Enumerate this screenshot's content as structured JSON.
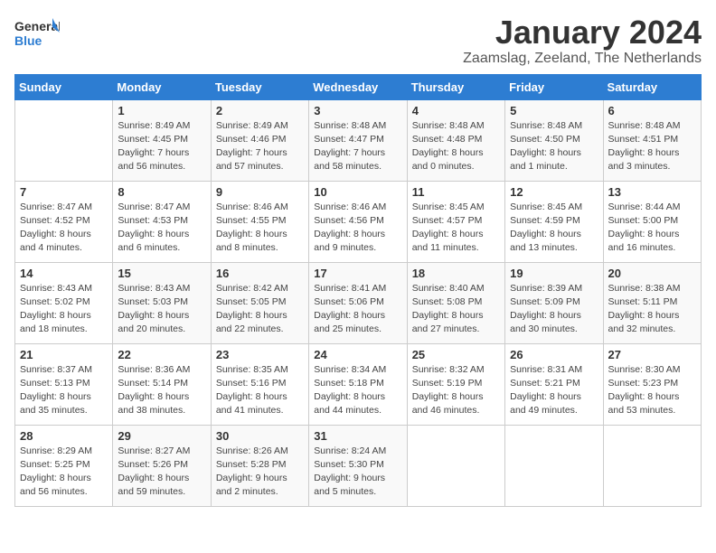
{
  "header": {
    "logo_general": "General",
    "logo_blue": "Blue",
    "title": "January 2024",
    "subtitle": "Zaamslag, Zeeland, The Netherlands"
  },
  "days_of_week": [
    "Sunday",
    "Monday",
    "Tuesday",
    "Wednesday",
    "Thursday",
    "Friday",
    "Saturday"
  ],
  "weeks": [
    [
      {
        "day": "",
        "info": ""
      },
      {
        "day": "1",
        "info": "Sunrise: 8:49 AM\nSunset: 4:45 PM\nDaylight: 7 hours\nand 56 minutes."
      },
      {
        "day": "2",
        "info": "Sunrise: 8:49 AM\nSunset: 4:46 PM\nDaylight: 7 hours\nand 57 minutes."
      },
      {
        "day": "3",
        "info": "Sunrise: 8:48 AM\nSunset: 4:47 PM\nDaylight: 7 hours\nand 58 minutes."
      },
      {
        "day": "4",
        "info": "Sunrise: 8:48 AM\nSunset: 4:48 PM\nDaylight: 8 hours\nand 0 minutes."
      },
      {
        "day": "5",
        "info": "Sunrise: 8:48 AM\nSunset: 4:50 PM\nDaylight: 8 hours\nand 1 minute."
      },
      {
        "day": "6",
        "info": "Sunrise: 8:48 AM\nSunset: 4:51 PM\nDaylight: 8 hours\nand 3 minutes."
      }
    ],
    [
      {
        "day": "7",
        "info": "Sunrise: 8:47 AM\nSunset: 4:52 PM\nDaylight: 8 hours\nand 4 minutes."
      },
      {
        "day": "8",
        "info": "Sunrise: 8:47 AM\nSunset: 4:53 PM\nDaylight: 8 hours\nand 6 minutes."
      },
      {
        "day": "9",
        "info": "Sunrise: 8:46 AM\nSunset: 4:55 PM\nDaylight: 8 hours\nand 8 minutes."
      },
      {
        "day": "10",
        "info": "Sunrise: 8:46 AM\nSunset: 4:56 PM\nDaylight: 8 hours\nand 9 minutes."
      },
      {
        "day": "11",
        "info": "Sunrise: 8:45 AM\nSunset: 4:57 PM\nDaylight: 8 hours\nand 11 minutes."
      },
      {
        "day": "12",
        "info": "Sunrise: 8:45 AM\nSunset: 4:59 PM\nDaylight: 8 hours\nand 13 minutes."
      },
      {
        "day": "13",
        "info": "Sunrise: 8:44 AM\nSunset: 5:00 PM\nDaylight: 8 hours\nand 16 minutes."
      }
    ],
    [
      {
        "day": "14",
        "info": "Sunrise: 8:43 AM\nSunset: 5:02 PM\nDaylight: 8 hours\nand 18 minutes."
      },
      {
        "day": "15",
        "info": "Sunrise: 8:43 AM\nSunset: 5:03 PM\nDaylight: 8 hours\nand 20 minutes."
      },
      {
        "day": "16",
        "info": "Sunrise: 8:42 AM\nSunset: 5:05 PM\nDaylight: 8 hours\nand 22 minutes."
      },
      {
        "day": "17",
        "info": "Sunrise: 8:41 AM\nSunset: 5:06 PM\nDaylight: 8 hours\nand 25 minutes."
      },
      {
        "day": "18",
        "info": "Sunrise: 8:40 AM\nSunset: 5:08 PM\nDaylight: 8 hours\nand 27 minutes."
      },
      {
        "day": "19",
        "info": "Sunrise: 8:39 AM\nSunset: 5:09 PM\nDaylight: 8 hours\nand 30 minutes."
      },
      {
        "day": "20",
        "info": "Sunrise: 8:38 AM\nSunset: 5:11 PM\nDaylight: 8 hours\nand 32 minutes."
      }
    ],
    [
      {
        "day": "21",
        "info": "Sunrise: 8:37 AM\nSunset: 5:13 PM\nDaylight: 8 hours\nand 35 minutes."
      },
      {
        "day": "22",
        "info": "Sunrise: 8:36 AM\nSunset: 5:14 PM\nDaylight: 8 hours\nand 38 minutes."
      },
      {
        "day": "23",
        "info": "Sunrise: 8:35 AM\nSunset: 5:16 PM\nDaylight: 8 hours\nand 41 minutes."
      },
      {
        "day": "24",
        "info": "Sunrise: 8:34 AM\nSunset: 5:18 PM\nDaylight: 8 hours\nand 44 minutes."
      },
      {
        "day": "25",
        "info": "Sunrise: 8:32 AM\nSunset: 5:19 PM\nDaylight: 8 hours\nand 46 minutes."
      },
      {
        "day": "26",
        "info": "Sunrise: 8:31 AM\nSunset: 5:21 PM\nDaylight: 8 hours\nand 49 minutes."
      },
      {
        "day": "27",
        "info": "Sunrise: 8:30 AM\nSunset: 5:23 PM\nDaylight: 8 hours\nand 53 minutes."
      }
    ],
    [
      {
        "day": "28",
        "info": "Sunrise: 8:29 AM\nSunset: 5:25 PM\nDaylight: 8 hours\nand 56 minutes."
      },
      {
        "day": "29",
        "info": "Sunrise: 8:27 AM\nSunset: 5:26 PM\nDaylight: 8 hours\nand 59 minutes."
      },
      {
        "day": "30",
        "info": "Sunrise: 8:26 AM\nSunset: 5:28 PM\nDaylight: 9 hours\nand 2 minutes."
      },
      {
        "day": "31",
        "info": "Sunrise: 8:24 AM\nSunset: 5:30 PM\nDaylight: 9 hours\nand 5 minutes."
      },
      {
        "day": "",
        "info": ""
      },
      {
        "day": "",
        "info": ""
      },
      {
        "day": "",
        "info": ""
      }
    ]
  ]
}
